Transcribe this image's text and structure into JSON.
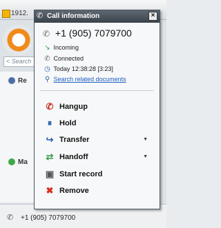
{
  "background": {
    "title": "1912.",
    "search_placeholder": "< Search",
    "rows": [
      "Re",
      "Ma"
    ]
  },
  "popup": {
    "title": "Call information",
    "phone_number": "+1 (905) 7079700",
    "status": "Incoming",
    "connection": "Connected",
    "time": "Today 12:38:28 [3:23]",
    "search_link": "Search related documents",
    "actions": [
      {
        "label": "Hangup"
      },
      {
        "label": "Hold"
      },
      {
        "label": "Transfer"
      },
      {
        "label": "Handoff"
      },
      {
        "label": "Start record"
      },
      {
        "label": "Remove"
      }
    ]
  },
  "statusbar": {
    "number": "+1 (905) 7079700"
  },
  "icons": {
    "phone": "phone-icon",
    "close": "close-icon",
    "incoming": "incoming-icon",
    "connected": "connected-icon",
    "clock": "clock-icon",
    "search": "search-icon",
    "hangup": "hangup-icon",
    "hold": "hold-icon",
    "transfer": "transfer-icon",
    "handoff": "handoff-icon",
    "record": "record-icon",
    "remove": "remove-icon"
  }
}
